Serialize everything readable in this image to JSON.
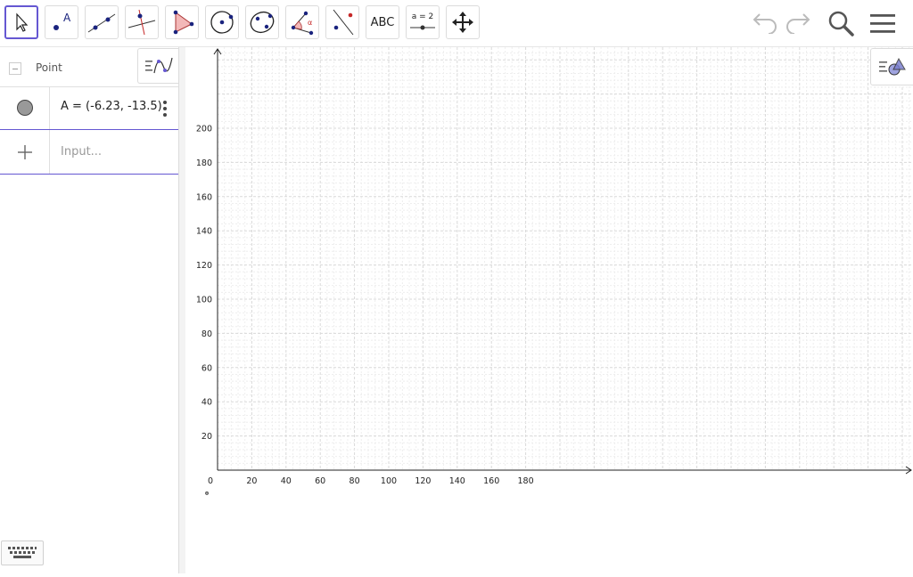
{
  "tools": [
    {
      "name": "move-tool",
      "active": true
    },
    {
      "name": "point-tool"
    },
    {
      "name": "line-tool"
    },
    {
      "name": "perpendicular-line-tool"
    },
    {
      "name": "polygon-tool"
    },
    {
      "name": "circle-tool"
    },
    {
      "name": "ellipse-tool"
    },
    {
      "name": "angle-tool"
    },
    {
      "name": "reflect-tool"
    },
    {
      "name": "text-tool",
      "label": "ABC"
    },
    {
      "name": "slider-tool",
      "label": "a = 2"
    },
    {
      "name": "move-graphics-view-tool"
    }
  ],
  "topbar": {
    "undo_icon": "undo-icon",
    "redo_icon": "redo-icon",
    "search_icon": "search-icon",
    "menu_icon": "menu-icon"
  },
  "algebra": {
    "group_label": "Point",
    "items": [
      {
        "text": "A = (-6.23, -13.5)"
      }
    ],
    "input_placeholder": "Input..."
  },
  "graphics": {
    "x_ticks": [
      "0",
      "20",
      "40",
      "60",
      "80",
      "100",
      "120",
      "140",
      "160",
      "180"
    ],
    "y_ticks": [
      "20",
      "40",
      "60",
      "80",
      "100",
      "120",
      "140",
      "160",
      "180",
      "200"
    ],
    "grid": true
  },
  "colors": {
    "accent": "#6557d2",
    "point_fill": "#999999"
  }
}
